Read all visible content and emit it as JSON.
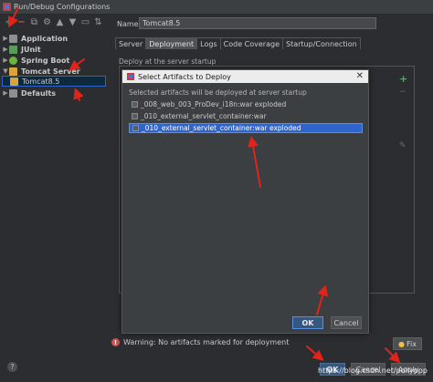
{
  "window": {
    "title": "Run/Debug Configurations"
  },
  "name_field": {
    "label": "Name:",
    "value": "Tomcat8.5"
  },
  "tree": {
    "items": [
      {
        "label": "Application",
        "icon": "application-icon",
        "expandable": true,
        "expanded": false
      },
      {
        "label": "JUnit",
        "icon": "junit-icon",
        "expandable": true,
        "expanded": false
      },
      {
        "label": "Spring Boot",
        "icon": "spring-boot-icon",
        "expandable": true,
        "expanded": false
      },
      {
        "label": "Tomcat Server",
        "icon": "tomcat-icon",
        "expandable": true,
        "expanded": true
      },
      {
        "label": "Tomcat8.5",
        "icon": "tomcat-icon",
        "expandable": false,
        "selected": true
      },
      {
        "label": "Defaults",
        "icon": "defaults-icon",
        "expandable": true,
        "expanded": false
      }
    ]
  },
  "tabs": [
    {
      "label": "Server"
    },
    {
      "label": "Deployment",
      "active": true
    },
    {
      "label": "Logs"
    },
    {
      "label": "Code Coverage"
    },
    {
      "label": "Startup/Connection"
    }
  ],
  "deployment": {
    "label": "Deploy at the server startup"
  },
  "modal": {
    "title": "Select Artifacts to Deploy",
    "subtitle": "Selected artifacts will be deployed at server startup",
    "artifacts": [
      {
        "label": "_008_web_003_ProDev_i18n:war exploded",
        "selected": false
      },
      {
        "label": "_010_external_servlet_container:war",
        "selected": false
      },
      {
        "label": "_010_external_servlet_container:war exploded",
        "selected": true
      }
    ],
    "ok_label": "OK",
    "cancel_label": "Cancel",
    "close_glyph": "✕"
  },
  "warning": {
    "text": "Warning: No artifacts marked for deployment",
    "fix_label": "Fix"
  },
  "footer": {
    "ok_label": "OK",
    "cancel_label": "Cancel",
    "apply_label": "Apply",
    "watermark": "https://blog.csdn.net/pollyppp"
  },
  "colors": {
    "accent": "#2f65ca",
    "annotation": "#e2231a",
    "add": "#59a869",
    "remove": "#c75450"
  }
}
